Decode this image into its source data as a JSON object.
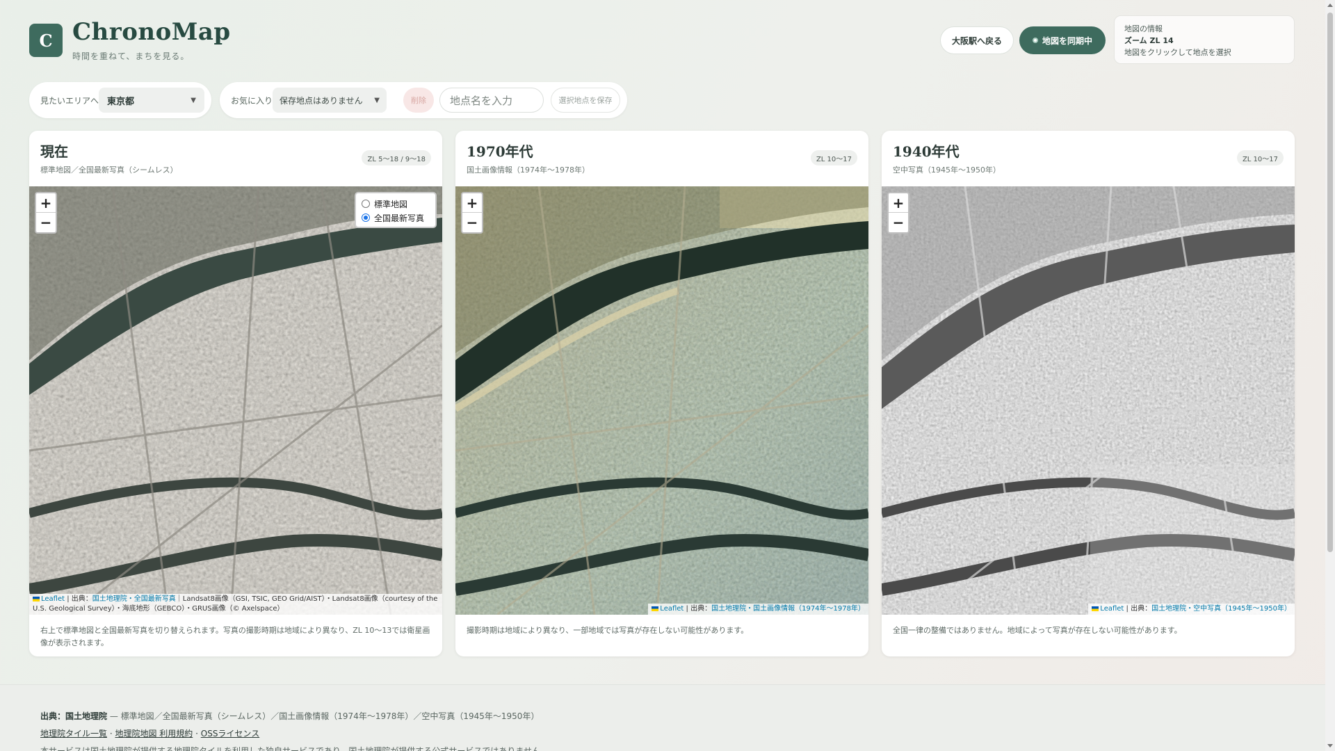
{
  "header": {
    "logo_letter": "C",
    "title": "ChronoMap",
    "tagline": "時間を重ねて、まちを見る。",
    "back_button": "大阪駅へ戻る",
    "sync_button": "地図を同期中",
    "info": {
      "title": "地図の情報",
      "zoom": "ズーム ZL 14",
      "hint": "地図をクリックして地点を選択"
    }
  },
  "toolbar": {
    "area_label": "見たいエリアへ",
    "area_value": "東京都",
    "favorites_label": "お気に入り",
    "favorites_value": "保存地点はありません",
    "delete_button": "削除",
    "place_placeholder": "地点名を入力",
    "save_button": "選択地点を保存"
  },
  "panels": [
    {
      "title": "現在",
      "subtitle": "標準地図／全国最新写真（シームレス）",
      "zl": "ZL 5〜18 / 9〜18",
      "layers": [
        "標準地図",
        "全国最新写真"
      ],
      "selected_layer": "全国最新写真",
      "attribution_leaflet": "Leaflet",
      "attribution_prefix": " | 出典：",
      "attribution_link": "国土地理院・全国最新写真",
      "attribution_rest": "｜Landsat8画像（GSI, TSIC, GEO Grid/AIST）・Landsat8画像（courtesy of the U.S. Geological Survey）・海底地形（GEBCO）・GRUS画像（© Axelspace）",
      "note": "右上で標準地図と全国最新写真を切り替えられます。写真の撮影時期は地域により異なり、ZL 10〜13では衛星画像が表示されます。"
    },
    {
      "title": "1970年代",
      "subtitle": "国土画像情報（1974年〜1978年）",
      "zl": "ZL 10〜17",
      "attribution_leaflet": "Leaflet",
      "attribution_prefix": " | 出典：",
      "attribution_link": "国土地理院・国土画像情報（1974年〜1978年）",
      "note": "撮影時期は地域により異なり、一部地域では写真が存在しない可能性があります。"
    },
    {
      "title": "1940年代",
      "subtitle": "空中写真（1945年〜1950年）",
      "zl": "ZL 10〜17",
      "attribution_leaflet": "Leaflet",
      "attribution_prefix": " | 出典：",
      "attribution_link": "国土地理院・空中写真（1945年〜1950年）",
      "note": "全国一律の整備ではありません。地域によって写真が存在しない可能性があります。"
    }
  ],
  "map_controls": {
    "zoom_in": "+",
    "zoom_out": "−"
  },
  "footer": {
    "source_label": "出典：国土地理院",
    "source_text": " — 標準地図／全国最新写真（シームレス）／国土画像情報（1974年〜1978年）／空中写真（1945年〜1950年）",
    "link_tiles": "地理院タイル一覧",
    "link_terms": "地理院地図 利用規約",
    "link_oss": "OSSライセンス",
    "separator": " · ",
    "disclaimer": "本サービスは国土地理院が提供する地理院タイルを利用した独自サービスであり、国土地理院が提供する公式サービスではありません。"
  },
  "colors": {
    "brand": "#3e6b5e",
    "link": "#0078a8"
  }
}
